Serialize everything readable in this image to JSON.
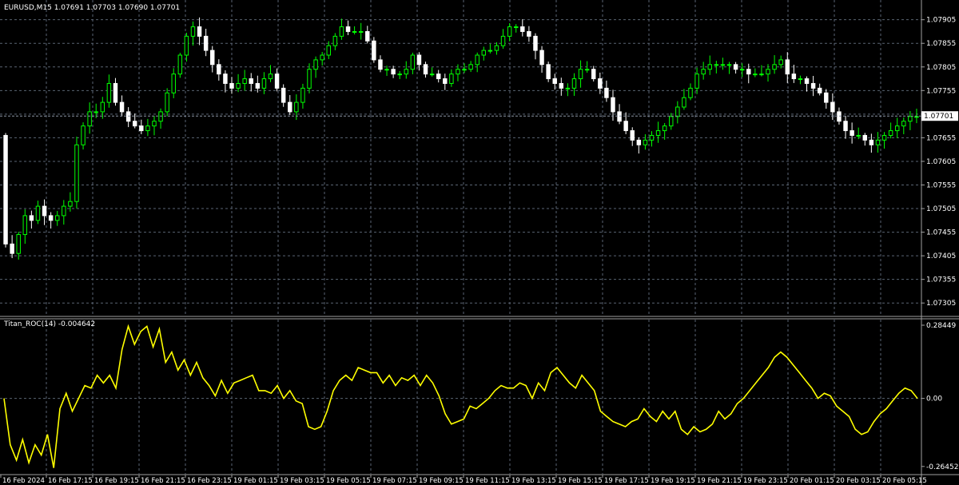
{
  "colors": {
    "background": "#000000",
    "grid": "#5a6473",
    "bull": "#00ff00",
    "bear": "#ffffff",
    "indicator": "#ffff00",
    "axis_text": "#ffffff",
    "price_label_bg": "#ffffff",
    "price_label_text": "#000000"
  },
  "main_panel": {
    "header": "EURUSD,M15  1.07691 1.07703 1.07690 1.07701",
    "current_price": 1.07701,
    "current_price_label": "1.07701",
    "ylim": [
      1.0728,
      1.0794
    ],
    "price_ticks": [
      "1.07305",
      "1.07355",
      "1.07405",
      "1.07455",
      "1.07505",
      "1.07555",
      "1.07605",
      "1.07655",
      "1.07705",
      "1.07755",
      "1.07805",
      "1.07855",
      "1.07905"
    ]
  },
  "indicator_panel": {
    "header": "Titan_ROC(14) -0.004642",
    "ylim": [
      -0.29,
      0.3
    ],
    "ticks": [
      "0.28449",
      "0.00",
      "-0.26452"
    ]
  },
  "x_axis_labels": [
    "16 Feb 2024",
    "16 Feb 17:15",
    "16 Feb 19:15",
    "16 Feb 21:15",
    "16 Feb 23:15",
    "19 Feb 01:15",
    "19 Feb 03:15",
    "19 Feb 05:15",
    "19 Feb 07:15",
    "19 Feb 09:15",
    "19 Feb 11:15",
    "19 Feb 13:15",
    "19 Feb 15:15",
    "19 Feb 17:15",
    "19 Feb 19:15",
    "19 Feb 21:15",
    "19 Feb 23:15",
    "20 Feb 01:15",
    "20 Feb 03:15",
    "20 Feb 05:15"
  ],
  "chart_data": [
    {
      "type": "candlestick",
      "title": "EURUSD,M15",
      "ylim": [
        1.0728,
        1.0794
      ],
      "close": [
        1.0743,
        1.0741,
        1.0745,
        1.0749,
        1.0748,
        1.0751,
        1.0749,
        1.0748,
        1.0749,
        1.0751,
        1.0752,
        1.0764,
        1.0768,
        1.0771,
        1.0771,
        1.0773,
        1.0777,
        1.0773,
        1.0771,
        1.0769,
        1.0768,
        1.0767,
        1.0768,
        1.0769,
        1.0771,
        1.0775,
        1.0779,
        1.0783,
        1.0787,
        1.0789,
        1.0787,
        1.0784,
        1.0781,
        1.0779,
        1.0777,
        1.0776,
        1.0777,
        1.0778,
        1.0777,
        1.0776,
        1.0778,
        1.0779,
        1.0776,
        1.0773,
        1.0771,
        1.0773,
        1.0776,
        1.078,
        1.0782,
        1.0783,
        1.0785,
        1.0787,
        1.0789,
        1.0788,
        1.0788,
        1.0788,
        1.0786,
        1.0782,
        1.078,
        1.078,
        1.0779,
        1.0779,
        1.078,
        1.0783,
        1.0781,
        1.0779,
        1.0779,
        1.0778,
        1.0777,
        1.0779,
        1.078,
        1.078,
        1.0781,
        1.0783,
        1.0784,
        1.0784,
        1.0785,
        1.0787,
        1.0789,
        1.0789,
        1.0788,
        1.0787,
        1.0784,
        1.0781,
        1.0778,
        1.0777,
        1.0776,
        1.0776,
        1.0778,
        1.078,
        1.078,
        1.0778,
        1.0776,
        1.0774,
        1.0771,
        1.0769,
        1.0767,
        1.0765,
        1.0764,
        1.0765,
        1.0766,
        1.0767,
        1.0768,
        1.077,
        1.0772,
        1.0774,
        1.0776,
        1.0779,
        1.078,
        1.0781,
        1.0781,
        1.0781,
        1.0781,
        1.078,
        1.078,
        1.0779,
        1.0779,
        1.0779,
        1.078,
        1.0781,
        1.0782,
        1.0779,
        1.0778,
        1.0778,
        1.0777,
        1.0776,
        1.0775,
        1.0773,
        1.0771,
        1.0769,
        1.0767,
        1.0766,
        1.0766,
        1.0765,
        1.0764,
        1.0765,
        1.0766,
        1.0767,
        1.0768,
        1.0769,
        1.077,
        1.077
      ],
      "current_price": 1.07701
    },
    {
      "type": "line",
      "title": "Titan_ROC(14)",
      "ylim": [
        -0.29,
        0.3
      ],
      "series": [
        {
          "name": "Titan_ROC(14)",
          "values": [
            0.0,
            -0.18,
            -0.24,
            -0.16,
            -0.25,
            -0.18,
            -0.22,
            -0.14,
            -0.27,
            -0.04,
            0.02,
            -0.05,
            0.0,
            0.05,
            0.04,
            0.09,
            0.06,
            0.09,
            0.04,
            0.19,
            0.28,
            0.21,
            0.26,
            0.28,
            0.2,
            0.27,
            0.14,
            0.18,
            0.11,
            0.15,
            0.09,
            0.14,
            0.08,
            0.05,
            0.01,
            0.07,
            0.02,
            0.06,
            0.07,
            0.08,
            0.09,
            0.03,
            0.03,
            0.02,
            0.05,
            0.0,
            0.03,
            -0.01,
            -0.02,
            -0.11,
            -0.12,
            -0.11,
            -0.05,
            0.03,
            0.07,
            0.09,
            0.07,
            0.12,
            0.11,
            0.1,
            0.1,
            0.06,
            0.09,
            0.05,
            0.08,
            0.07,
            0.09,
            0.05,
            0.09,
            0.06,
            0.01,
            -0.06,
            -0.1,
            -0.09,
            -0.08,
            -0.03,
            -0.04,
            -0.02,
            0.0,
            0.03,
            0.05,
            0.04,
            0.04,
            0.06,
            0.05,
            0.0,
            0.06,
            0.03,
            0.1,
            0.12,
            0.09,
            0.06,
            0.04,
            0.09,
            0.06,
            0.03,
            -0.05,
            -0.07,
            -0.09,
            -0.1,
            -0.11,
            -0.09,
            -0.08,
            -0.04,
            -0.07,
            -0.09,
            -0.05,
            -0.08,
            -0.05,
            -0.12,
            -0.14,
            -0.11,
            -0.13,
            -0.12,
            -0.1,
            -0.05,
            -0.08,
            -0.06,
            -0.02,
            0.0,
            0.03,
            0.06,
            0.09,
            0.12,
            0.16,
            0.18,
            0.16,
            0.13,
            0.1,
            0.07,
            0.04,
            0.0,
            0.02,
            0.01,
            -0.03,
            -0.05,
            -0.07,
            -0.12,
            -0.14,
            -0.13,
            -0.09,
            -0.06,
            -0.04,
            -0.01,
            0.02,
            0.04,
            0.03,
            0.0
          ]
        }
      ]
    }
  ]
}
